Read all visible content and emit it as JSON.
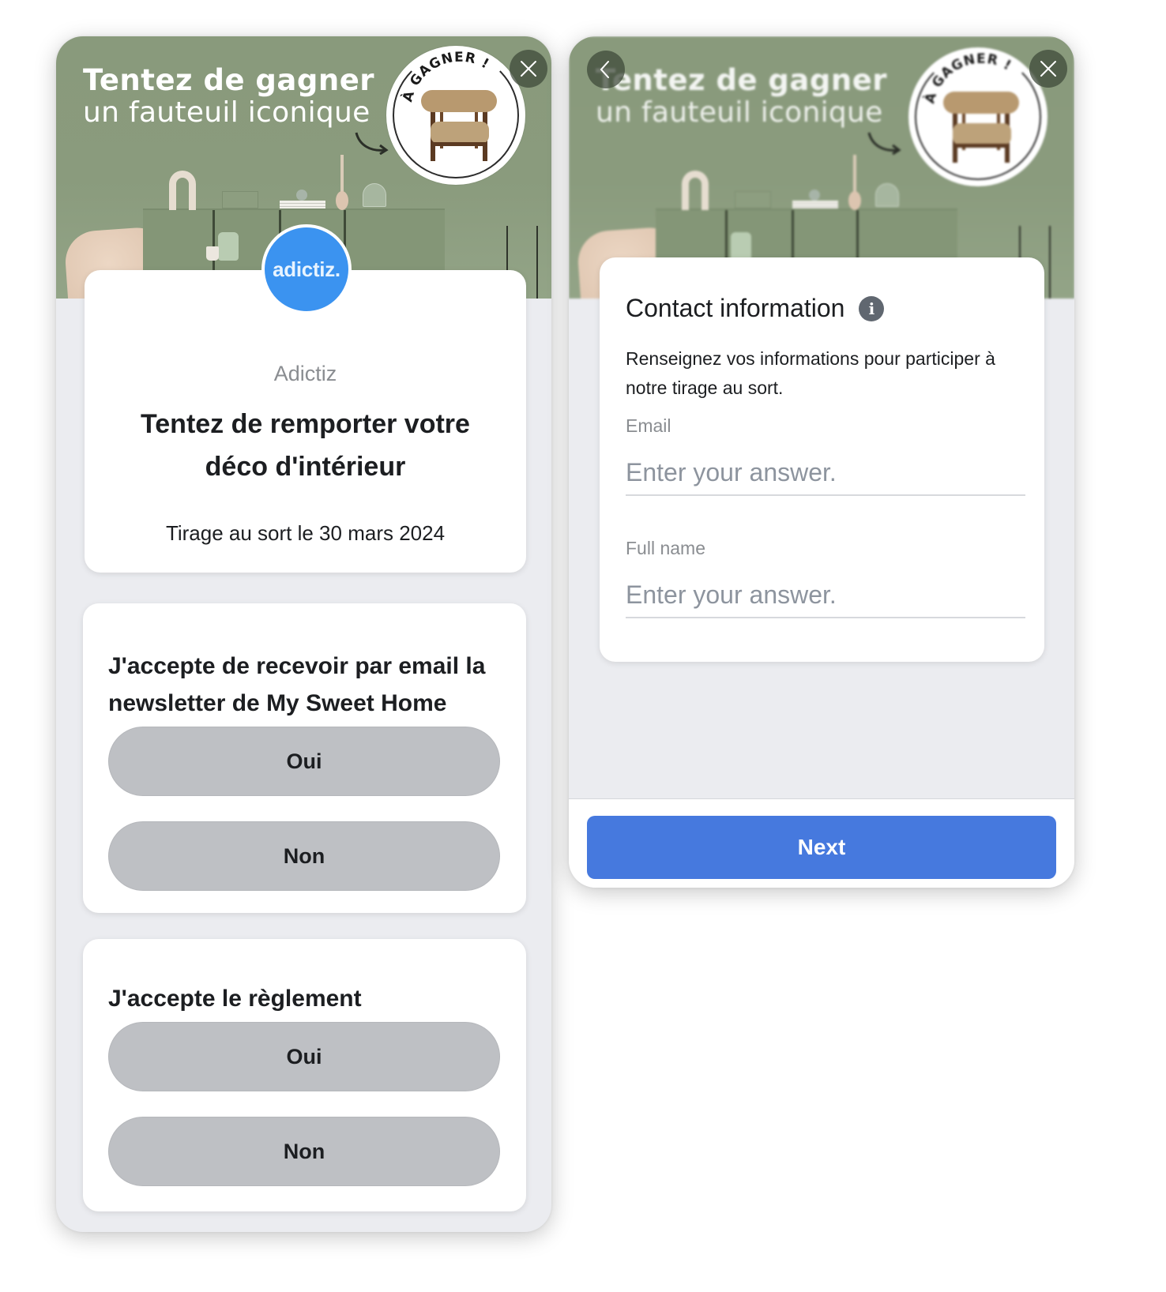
{
  "hero": {
    "headline_bold": "Tentez de gagner",
    "headline_light": "un fauteuil iconique",
    "badge_text": "À GAGNER !"
  },
  "left_panel": {
    "close_icon": "close-icon",
    "organizer": {
      "logo_text": "adictiz.",
      "name": "Adictiz"
    },
    "intro": {
      "title": "Tentez de remporter votre déco d'intérieur",
      "subtitle": "Tirage au sort le 30 mars 2024"
    },
    "questions": [
      {
        "title": "J'accepte de recevoir par email la newsletter de My Sweet Home",
        "options": [
          "Oui",
          "Non"
        ]
      },
      {
        "title": "J'accepte le règlement",
        "options": [
          "Oui",
          "Non"
        ]
      }
    ]
  },
  "right_panel": {
    "back_icon": "chevron-left-icon",
    "close_icon": "close-icon",
    "contact": {
      "title": "Contact information",
      "info_icon": "info-icon",
      "description": "Renseignez vos informations pour participer à notre tirage au sort.",
      "fields": [
        {
          "label": "Email",
          "value": "",
          "placeholder": "Enter your answer."
        },
        {
          "label": "Full name",
          "value": "",
          "placeholder": "Enter your answer."
        }
      ]
    },
    "next_label": "Next"
  },
  "colors": {
    "primary_button": "#4679de",
    "logo_blue": "#3b93f0",
    "choice_button": "#bec0c4",
    "panel_background": "#ebecf0",
    "hero_green": "#8a9b7d"
  }
}
